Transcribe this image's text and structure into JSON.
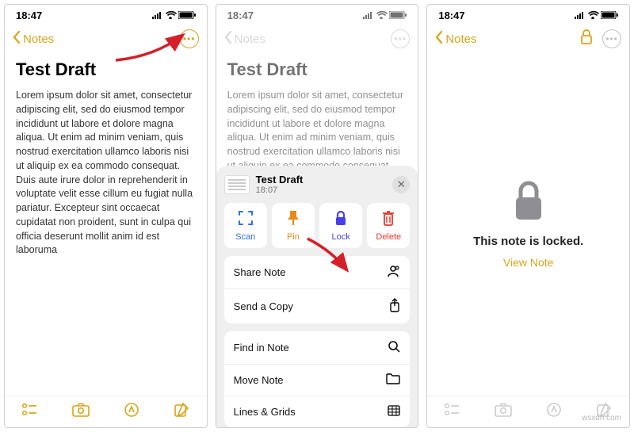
{
  "status": {
    "time": "18:47"
  },
  "nav": {
    "back_label": "Notes"
  },
  "note": {
    "title": "Test Draft",
    "body": "Lorem ipsum dolor sit amet, consectetur adipiscing elit, sed do eiusmod tempor incididunt ut labore et dolore magna aliqua. Ut enim ad minim veniam, quis nostrud exercitation ullamco laboris nisi ut aliquip ex ea commodo consequat. Duis aute irure dolor in reprehenderit in voluptate velit esse cillum eu fugiat nulla pariatur. Excepteur sint occaecat cupidatat non proident, sunt in culpa qui officia deserunt mollit anim id est laboruma",
    "body_short": "Lorem ipsum dolor sit amet, consectetur adipiscing elit, sed do eiusmod tempor incididunt ut labore et dolore magna aliqua. Ut enim ad minim veniam, quis nostrud exercitation ullamco laboris nisi ut aliquip ex ea commodo consequat. Duis aute irure dolor in reprehenderit in voluptate velit esse cillum eu fugiat nulla pariatur. Excepteur sint occaecat"
  },
  "sheet": {
    "title": "Test Draft",
    "time": "18:07",
    "actions": {
      "scan": "Scan",
      "pin": "Pin",
      "lock": "Lock",
      "delete": "Delete"
    },
    "menu": {
      "share": "Share Note",
      "send": "Send a Copy",
      "find": "Find in Note",
      "move": "Move Note",
      "lines": "Lines & Grids"
    }
  },
  "locked": {
    "message": "This note is locked.",
    "view": "View Note"
  },
  "watermark": "wsxdn.com"
}
